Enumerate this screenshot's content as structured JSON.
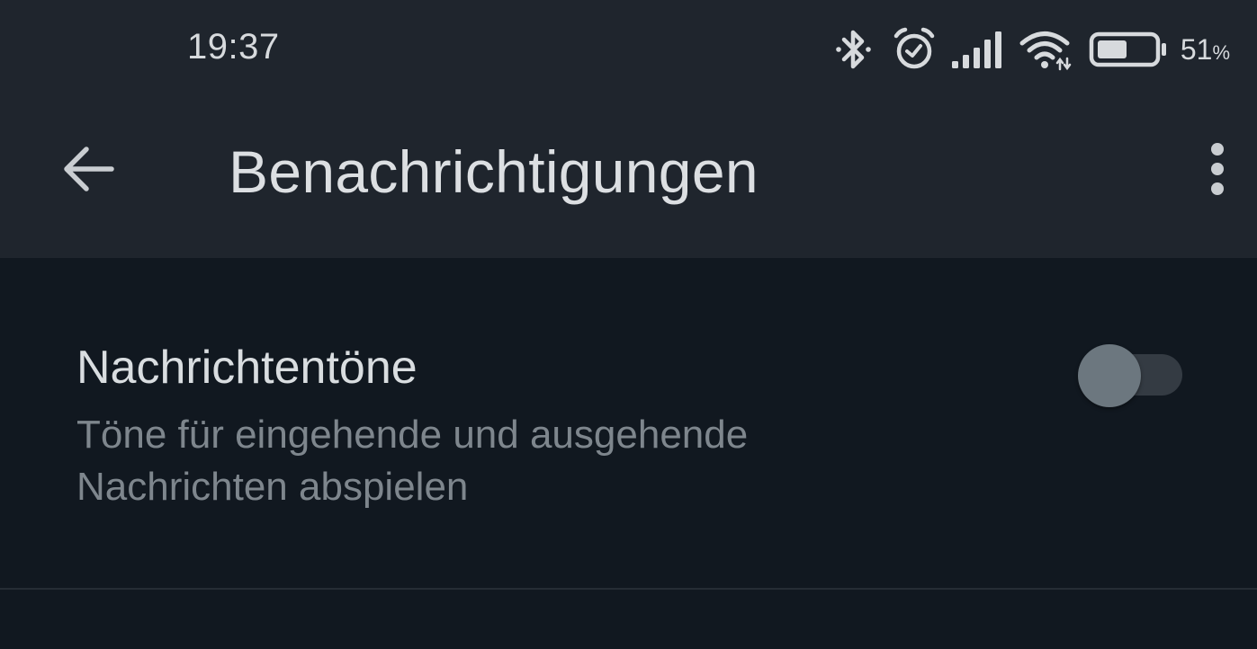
{
  "status_bar": {
    "time": "19:37",
    "battery_level": "51",
    "battery_unit": "%",
    "battery_fraction": 0.51,
    "icons": [
      "bluetooth-icon",
      "alarm-icon",
      "signal-icon",
      "wifi-icon",
      "battery-icon"
    ]
  },
  "app_bar": {
    "back_icon": "arrow-back-icon",
    "title": "Benachrichtigungen",
    "more_icon": "more-vert-icon"
  },
  "settings": [
    {
      "title": "Nachrichtentöne",
      "description": "Töne für eingehende und ausgehende Nachrichten abspielen",
      "enabled": false
    }
  ],
  "colors": {
    "app_bar_background": "#1f252d",
    "content_background": "#111820",
    "title_text": "#dcdfe2",
    "secondary_text": "#7e868d",
    "toggle_off_track": "#343b43",
    "toggle_off_thumb": "#6c777f"
  }
}
